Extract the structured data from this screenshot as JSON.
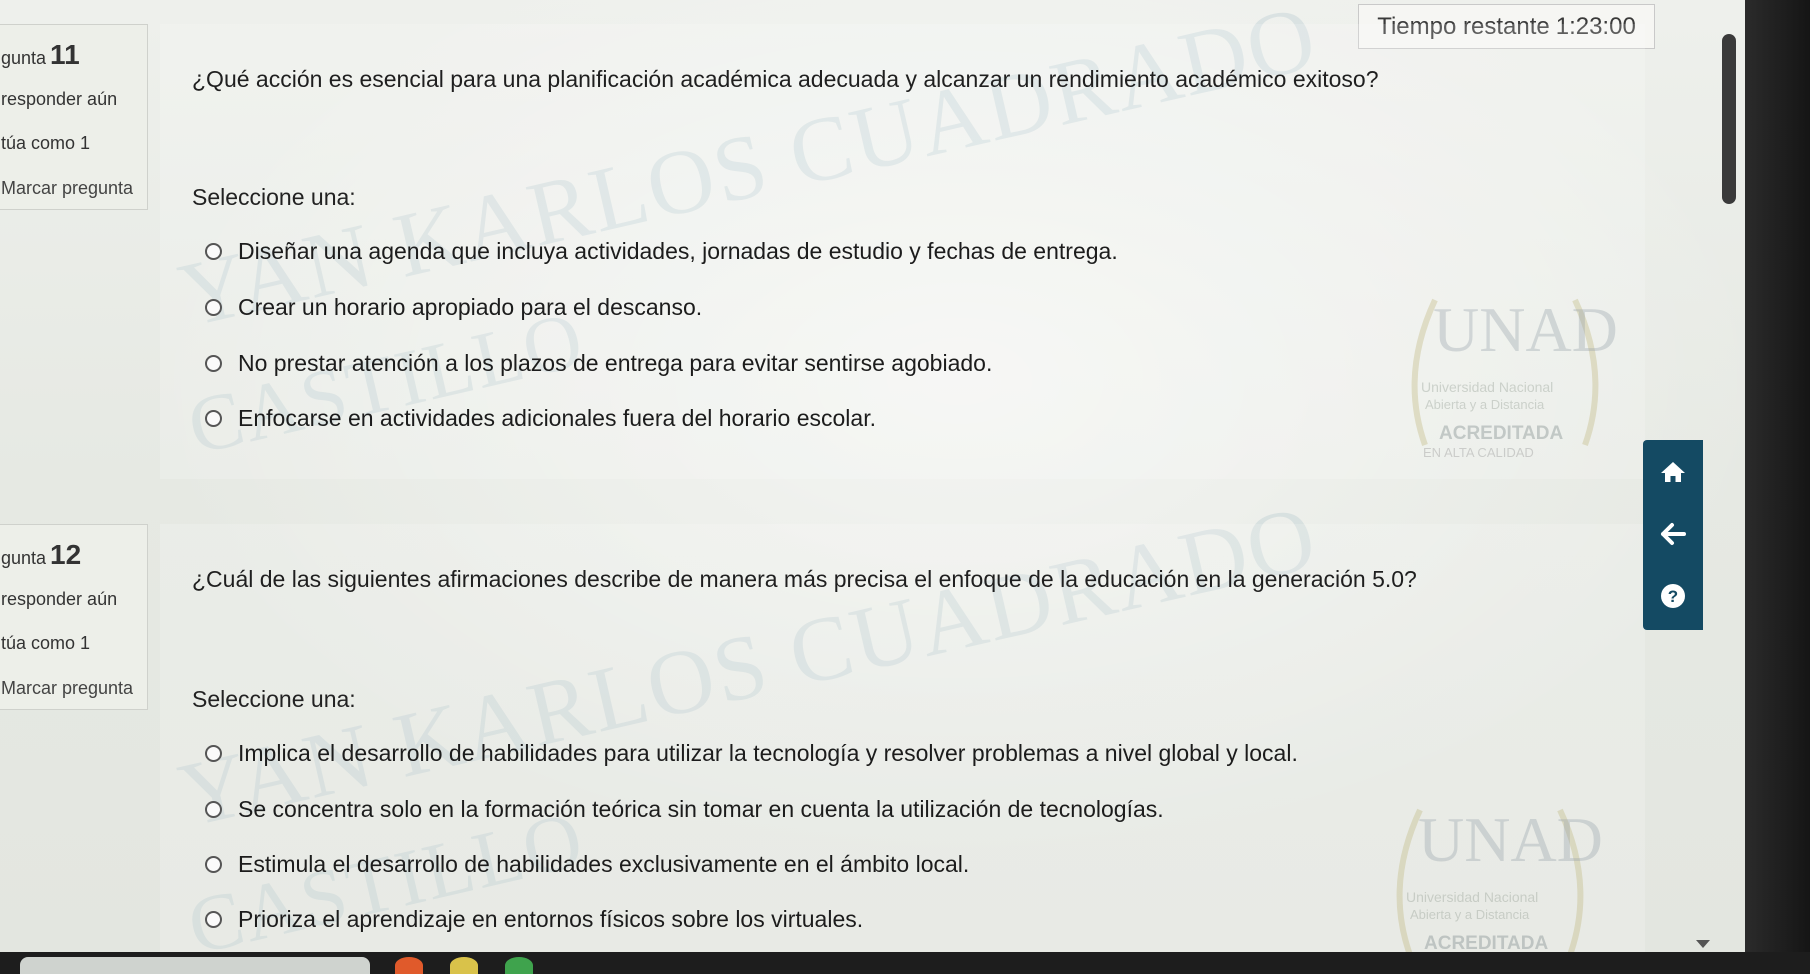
{
  "timer": {
    "label": "Tiempo restante",
    "value": "1:23:00"
  },
  "questions": [
    {
      "prefix": "gunta",
      "number": "11",
      "state": "responder aún",
      "grade": "túa como 1",
      "flag_label": "Marcar pregunta",
      "text": "¿Qué acción es esencial para una planificación académica adecuada y alcanzar un rendimiento académico exitoso?",
      "prompt": "Seleccione una:",
      "options": [
        "Diseñar una agenda que incluya actividades, jornadas de estudio y fechas de entrega.",
        "Crear un horario apropiado para el descanso.",
        "No prestar atención a los plazos de entrega para evitar sentirse agobiado.",
        "Enfocarse en actividades adicionales fuera del horario escolar."
      ]
    },
    {
      "prefix": "gunta",
      "number": "12",
      "state": "responder aún",
      "grade": "túa como 1",
      "flag_label": "Marcar pregunta",
      "text": "¿Cuál de las siguientes afirmaciones describe de manera más precisa el enfoque de la educación en la generación 5.0?",
      "prompt": "Seleccione una:",
      "options": [
        "Implica el desarrollo de habilidades para utilizar la tecnología y resolver problemas a nivel global y local.",
        "Se concentra solo en la formación teórica sin tomar en cuenta la utilización de tecnologías.",
        "Estimula el desarrollo de habilidades exclusivamente en el ámbito local.",
        "Prioriza el aprendizaje en entornos físicos sobre los virtuales."
      ]
    }
  ],
  "watermark": {
    "line1": "YAN KARLOS CUADRADO",
    "line2": "CASTILLO"
  },
  "logo": {
    "name": "UNAD",
    "subtitle1": "Universidad Nacional",
    "subtitle2": "Abierta y a Distancia",
    "badge": "ACREDITADA",
    "badge_sub": "EN ALTA CALIDAD"
  },
  "nav": {
    "icons": [
      "home-icon",
      "back-arrow-icon",
      "help-icon"
    ]
  },
  "colors": {
    "nav_bg": "#144a63",
    "text": "#1f1f1f"
  }
}
